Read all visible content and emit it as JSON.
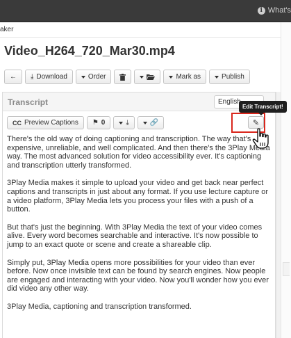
{
  "topbar": {
    "whats_new": "What's"
  },
  "breadcrumb": "aker",
  "page_title": "Video_H264_720_Mar30.mp4",
  "toolbar": {
    "download": "Download",
    "order": "Order",
    "mark_as": "Mark as",
    "publish": "Publish"
  },
  "transcript_panel": {
    "title": "Transcript",
    "language": "English",
    "preview_captions": "Preview Captions",
    "cc_label": "CC",
    "flag_count": "0",
    "edit_tooltip": "Edit Transcript!",
    "paragraphs": [
      "There's the old way of doing captioning and transcription. The way that's expensive, unreliable, and well complicated. And then there's the 3Play Media way. The most advanced solution for video accessibility ever. It's captioning and transcription utterly transformed.",
      "3Play Media makes it simple to upload your video and get back near perfect captions and transcripts in just about any format. If you use lecture capture or a video platform, 3Play Media lets you process your files with a push of a button.",
      "But that's just the beginning. With 3Play Media the text of your video comes alive. Every word becomes searchable and interactive. It's now possible to jump to an exact quote or scene and create a shareable clip.",
      "Simply put, 3Play Media opens more possibilities for your video than ever before. Now once invisible text can be found by search engines. Now people are engaged and interacting with your video. Now you'll wonder how you ever did video any other way.",
      "3Play Media, captioning and transcription transformed."
    ]
  },
  "colors": {
    "highlight": "#d9261c",
    "topbar": "#3a3a3a"
  }
}
